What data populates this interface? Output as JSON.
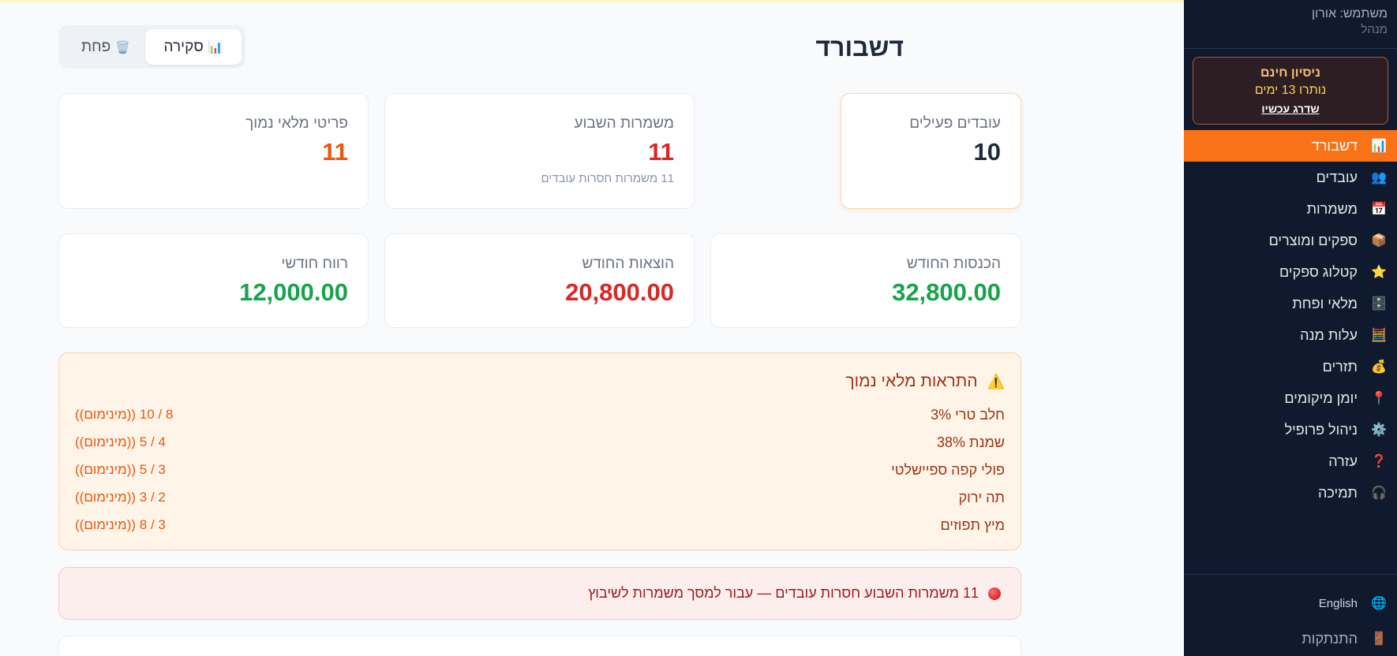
{
  "header": {
    "title": "דשבורד"
  },
  "tabs": [
    {
      "label": "סקירה",
      "icon": "📊"
    },
    {
      "label": "פחת",
      "icon": "🗑️"
    }
  ],
  "stats": {
    "active_employees": {
      "label": "עובדים פעילים",
      "value": "10"
    },
    "week_shifts": {
      "label": "משמרות השבוע",
      "value": "11",
      "sub": "11 משמרות חסרות עובדים"
    },
    "low_stock": {
      "label": "פריטי מלאי נמוך",
      "value": "11"
    },
    "income": {
      "label": "הכנסות החודש",
      "value": "32,800.00"
    },
    "expenses": {
      "label": "הוצאות החודש",
      "value": "20,800.00"
    },
    "profit": {
      "label": "רווח חודשי",
      "value": "12,000.00"
    }
  },
  "low_stock_alerts": {
    "title": "התראות מלאי נמוך",
    "icon": "⚠️",
    "items": [
      {
        "name": "חלב טרי 3%",
        "qty": "8 / 10 ((מינימום))"
      },
      {
        "name": "שמנת 38%",
        "qty": "4 / 5 ((מינימום))"
      },
      {
        "name": "פולי קפה ספיישלטי",
        "qty": "3 / 5 ((מינימום))"
      },
      {
        "name": "תה ירוק",
        "qty": "2 / 3 ((מינימום))"
      },
      {
        "name": "מיץ תפוזים",
        "qty": "3 / 8 ((מינימום))"
      }
    ]
  },
  "shift_alert": {
    "text": "11 משמרות השבוע חסרות עובדים — עבור למסך משמרות לשיבוץ"
  },
  "sidebar": {
    "user": "משתמש: אורון",
    "role": "מנהל",
    "trial": {
      "title": "ניסיון חינם",
      "days": "נותרו 13 ימים",
      "upgrade": "שדרג עכשיו"
    },
    "items": [
      {
        "label": "דשבורד",
        "icon": "📊",
        "active": true
      },
      {
        "label": "עובדים",
        "icon": "👥"
      },
      {
        "label": "משמרות",
        "icon": "📅"
      },
      {
        "label": "ספקים ומוצרים",
        "icon": "📦"
      },
      {
        "label": "קטלוג ספקים",
        "icon": "⭐"
      },
      {
        "label": "מלאי ופחת",
        "icon": "🗄️"
      },
      {
        "label": "עלות מנה",
        "icon": "🧮"
      },
      {
        "label": "תזרים",
        "icon": "💰"
      },
      {
        "label": "יומן מיקומים",
        "icon": "📍"
      },
      {
        "label": "ניהול פרופיל",
        "icon": "⚙️"
      },
      {
        "label": "עזרה",
        "icon": "❓"
      },
      {
        "label": "תמיכה",
        "icon": "🎧"
      }
    ],
    "language": {
      "label": "English",
      "icon": "🌐"
    },
    "logout": {
      "label": "התנתקות",
      "icon": "🚪"
    }
  },
  "colors": {
    "sidebar_bg": "#0f1a2e",
    "accent": "#f97316",
    "positive": "#16a34a",
    "negative": "#dc2626",
    "warning": "#ea580c"
  }
}
